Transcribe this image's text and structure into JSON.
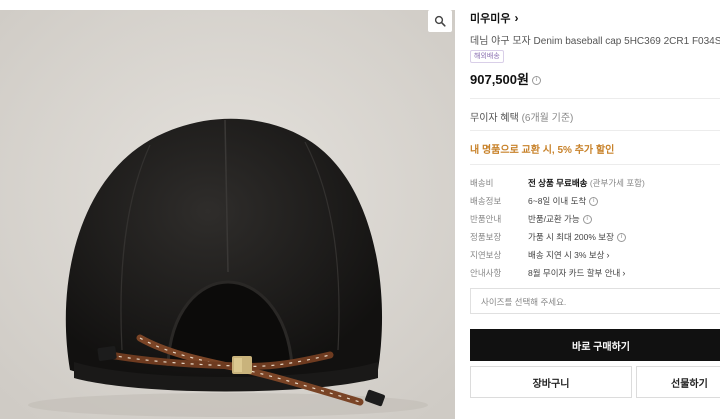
{
  "product": {
    "brand": "미우미우",
    "brand_chevron": "›",
    "title": "데님 야구 모자 Denim baseball cap 5HC369 2CR1 F034S",
    "badge": "해외배송",
    "price": "907,500원",
    "image_alt": "Black denim baseball cap, back view with brown drawstring"
  },
  "interest_free": {
    "label": "무이자 혜택",
    "period": "(6개월 기준)"
  },
  "promo": "내 명품으로 교환 시, 5% 추가 할인",
  "info_rows": [
    {
      "label": "배송비",
      "value": "전 상품 무료배송",
      "note": "(관부가세 포함)",
      "bold": true,
      "icon": ""
    },
    {
      "label": "배송정보",
      "value": "6~8일 이내 도착",
      "note": "",
      "bold": false,
      "icon": "info-icon"
    },
    {
      "label": "반품안내",
      "value": "반품/교환 가능",
      "note": "",
      "bold": false,
      "icon": "info-icon"
    },
    {
      "label": "정품보장",
      "value": "가품 시 최대 200% 보장",
      "note": "",
      "bold": false,
      "icon": "info-icon"
    },
    {
      "label": "지연보상",
      "value": "배송 지연 시 3% 보상",
      "note": "",
      "bold": false,
      "icon": "chevron-right-icon"
    },
    {
      "label": "안내사항",
      "value": "8월 무이자 카드 할부 안내",
      "note": "",
      "bold": false,
      "icon": "chevron-right-icon"
    }
  ],
  "size_select": {
    "placeholder": "사이즈를 선택해 주세요."
  },
  "buttons": {
    "buy": "바로 구매하기",
    "cart": "장바구니",
    "gift": "선물하기"
  },
  "icons": {
    "zoom": "magnifier-icon"
  },
  "colors": {
    "accent_promo": "#c8822a",
    "badge": "#8a6fb0",
    "buy_button": "#111111"
  }
}
